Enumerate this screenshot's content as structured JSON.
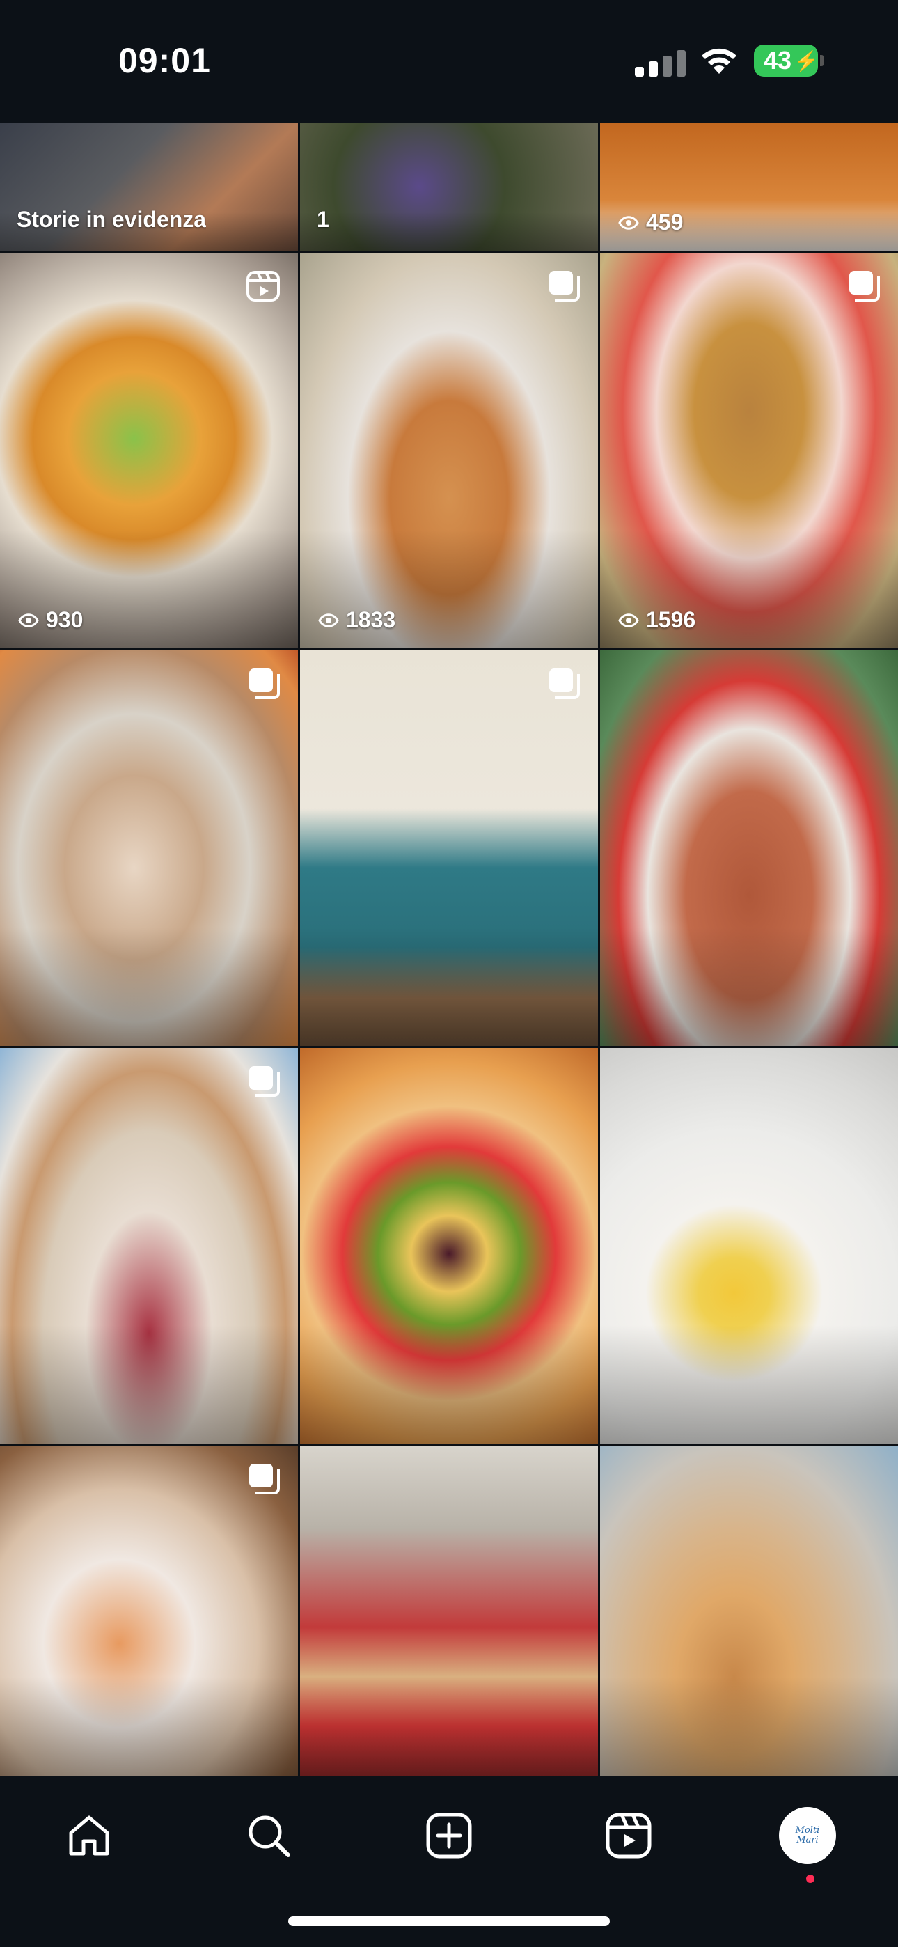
{
  "status_bar": {
    "time": "09:01",
    "battery": "43"
  },
  "profile_grid": {
    "highlight_caption": "Storie in evidenza",
    "highlight_count": "1",
    "views": [
      "459",
      "930",
      "1833",
      "1596"
    ]
  },
  "icons": {
    "home": "home-icon",
    "search": "search-icon",
    "create": "create-icon",
    "reels": "reels-icon",
    "profile": "profile-avatar"
  },
  "avatar": {
    "line1": "Molti",
    "line2": "Mari"
  },
  "colors": {
    "background": "#0b0f14",
    "battery": "#34c759",
    "notification_dot": "#ff2d55"
  }
}
